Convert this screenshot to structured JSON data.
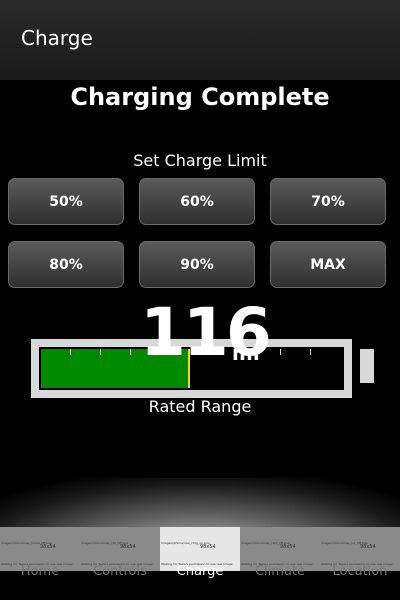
{
  "header": {
    "title": "Charge"
  },
  "status": {
    "text": "Charging Complete"
  },
  "charge_limit": {
    "label": "Set Charge Limit",
    "options": [
      "50%",
      "60%",
      "70%",
      "80%",
      "90%",
      "MAX"
    ]
  },
  "battery": {
    "range_value": "116",
    "range_unit": "mi",
    "caption": "Rated Range",
    "fill_fraction": 0.49,
    "colors": {
      "fill": "#008a00",
      "outline": "#d8d8d8",
      "marker": "#e6e600"
    }
  },
  "tabs": [
    {
      "label": "Home",
      "thumb_alt": "images/iphone/nav_home_off.png",
      "thumb_dims": "98x54",
      "thumb_note": "Waiting for Tesla's permission to use real image",
      "active": false
    },
    {
      "label": "Controls",
      "thumb_alt": "images/iphone/nav_ctrl_off.png",
      "thumb_dims": "98x54",
      "thumb_note": "Waiting for Tesla's permission to use real image",
      "active": false
    },
    {
      "label": "Charge",
      "thumb_alt": "images/iphone/nav_chrg_on.png",
      "thumb_dims": "98x54",
      "thumb_note": "Waiting for Tesla's permission to use real image",
      "active": true
    },
    {
      "label": "Climate",
      "thumb_alt": "images/iphone/nav_clim_off.png",
      "thumb_dims": "98x54",
      "thumb_note": "Waiting for Tesla's permission to use real image",
      "active": false
    },
    {
      "label": "Location",
      "thumb_alt": "images/iphone/nav_loc_off.png",
      "thumb_dims": "98x54",
      "thumb_note": "Waiting for Tesla's permission to use real image",
      "active": false
    }
  ]
}
